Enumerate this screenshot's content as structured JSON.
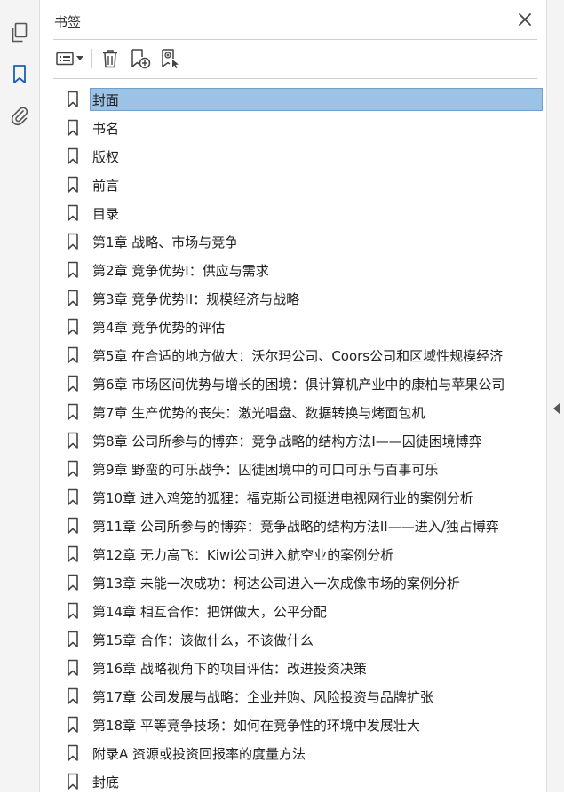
{
  "panel": {
    "title": "书签"
  },
  "rail": {
    "items": [
      {
        "icon": "pages-icon"
      },
      {
        "icon": "bookmark-icon",
        "active": true
      },
      {
        "icon": "attachment-icon"
      }
    ]
  },
  "toolbar": {
    "buttons": [
      "options-menu",
      "delete-bookmark",
      "new-bookmark",
      "new-bookmark-from-structure"
    ]
  },
  "bookmarks": [
    {
      "label": "封面",
      "selected": true
    },
    {
      "label": "书名"
    },
    {
      "label": "版权"
    },
    {
      "label": "前言"
    },
    {
      "label": "目录"
    },
    {
      "label": "第1章 战略、市场与竞争"
    },
    {
      "label": "第2章 竞争优势I：供应与需求"
    },
    {
      "label": "第3章 竞争优势II：规模经济与战略"
    },
    {
      "label": "第4章 竞争优势的评估"
    },
    {
      "label": "第5章 在合适的地方做大：沃尔玛公司、Coors公司和区域性规模经济"
    },
    {
      "label": "第6章 市场区间优势与增长的困境：俱计算机产业中的康柏与苹果公司"
    },
    {
      "label": "第7章 生产优势的丧失：激光唱盘、数据转换与烤面包机"
    },
    {
      "label": "第8章 公司所参与的博弈：竞争战略的结构方法I——囚徒困境博弈"
    },
    {
      "label": "第9章 野蛮的可乐战争：囚徒困境中的可口可乐与百事可乐"
    },
    {
      "label": "第10章 进入鸡笼的狐狸：福克斯公司挺进电视网行业的案例分析"
    },
    {
      "label": "第11章 公司所参与的博弈：竞争战略的结构方法II——进入/独占博弈"
    },
    {
      "label": "第12章 无力高飞：Kiwi公司进入航空业的案例分析"
    },
    {
      "label": "第13章 未能一次成功：柯达公司进入一次成像市场的案例分析"
    },
    {
      "label": "第14章 相互合作：把饼做大，公平分配"
    },
    {
      "label": "第15章 合作：该做什么，不该做什么"
    },
    {
      "label": "第16章 战略视角下的项目评估：改进投资决策"
    },
    {
      "label": "第17章 公司发展与战略：企业并购、风险投资与品牌扩张"
    },
    {
      "label": "第18章 平等竞争技场：如何在竞争性的环境中发展壮大"
    },
    {
      "label": "附录A 资源或投资回报率的度量方法"
    },
    {
      "label": "封底"
    }
  ],
  "colors": {
    "selection_fill": "#9cc3e5",
    "selection_border": "#6fa1cf",
    "accent": "#1a5fb4"
  }
}
